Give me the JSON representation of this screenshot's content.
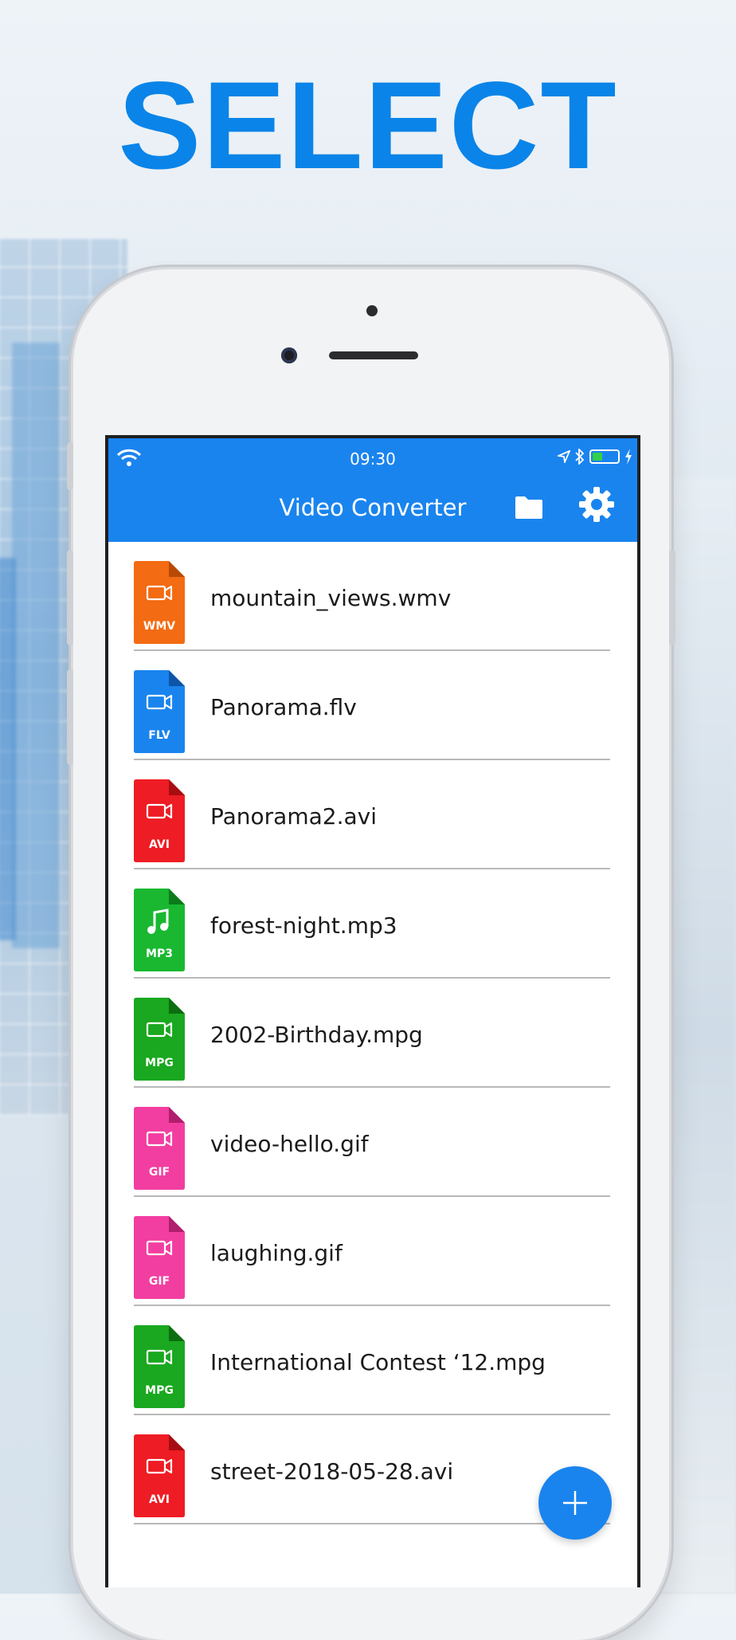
{
  "headline": "SELECT",
  "status_bar": {
    "time": "09:30"
  },
  "app_bar": {
    "title": "Video Converter"
  },
  "colors": {
    "primary": "#1a84ee",
    "wmv": "#f36b12",
    "flv": "#1a84ee",
    "avi": "#ee1c24",
    "mp3": "#19b830",
    "mpg": "#19a81f",
    "gif": "#f23ea0"
  },
  "files": [
    {
      "name": "mountain_views.wmv",
      "ext": "WMV",
      "color": "#f36b12",
      "dark": "#b94a05",
      "icon": "video-icon"
    },
    {
      "name": "Panorama.flv",
      "ext": "FLV",
      "color": "#1a84ee",
      "dark": "#0d55a8",
      "icon": "video-icon"
    },
    {
      "name": "Panorama2.avi",
      "ext": "AVI",
      "color": "#ee1c24",
      "dark": "#a70d12",
      "icon": "video-icon"
    },
    {
      "name": "forest-night.mp3",
      "ext": "MP3",
      "color": "#19b830",
      "dark": "#0d7a1c",
      "icon": "music-note-icon"
    },
    {
      "name": "2002-Birthday.mpg",
      "ext": "MPG",
      "color": "#19a81f",
      "dark": "#0c6d11",
      "icon": "video-icon"
    },
    {
      "name": "video-hello.gif",
      "ext": "GIF",
      "color": "#f23ea0",
      "dark": "#b01e6e",
      "icon": "video-icon"
    },
    {
      "name": "laughing.gif",
      "ext": "GIF",
      "color": "#f23ea0",
      "dark": "#b01e6e",
      "icon": "video-icon"
    },
    {
      "name": "International Contest ‘12.mpg",
      "ext": "MPG",
      "color": "#19a81f",
      "dark": "#0c6d11",
      "icon": "video-icon"
    },
    {
      "name": "street-2018-05-28.avi",
      "ext": "AVI",
      "color": "#ee1c24",
      "dark": "#a70d12",
      "icon": "video-icon"
    }
  ]
}
